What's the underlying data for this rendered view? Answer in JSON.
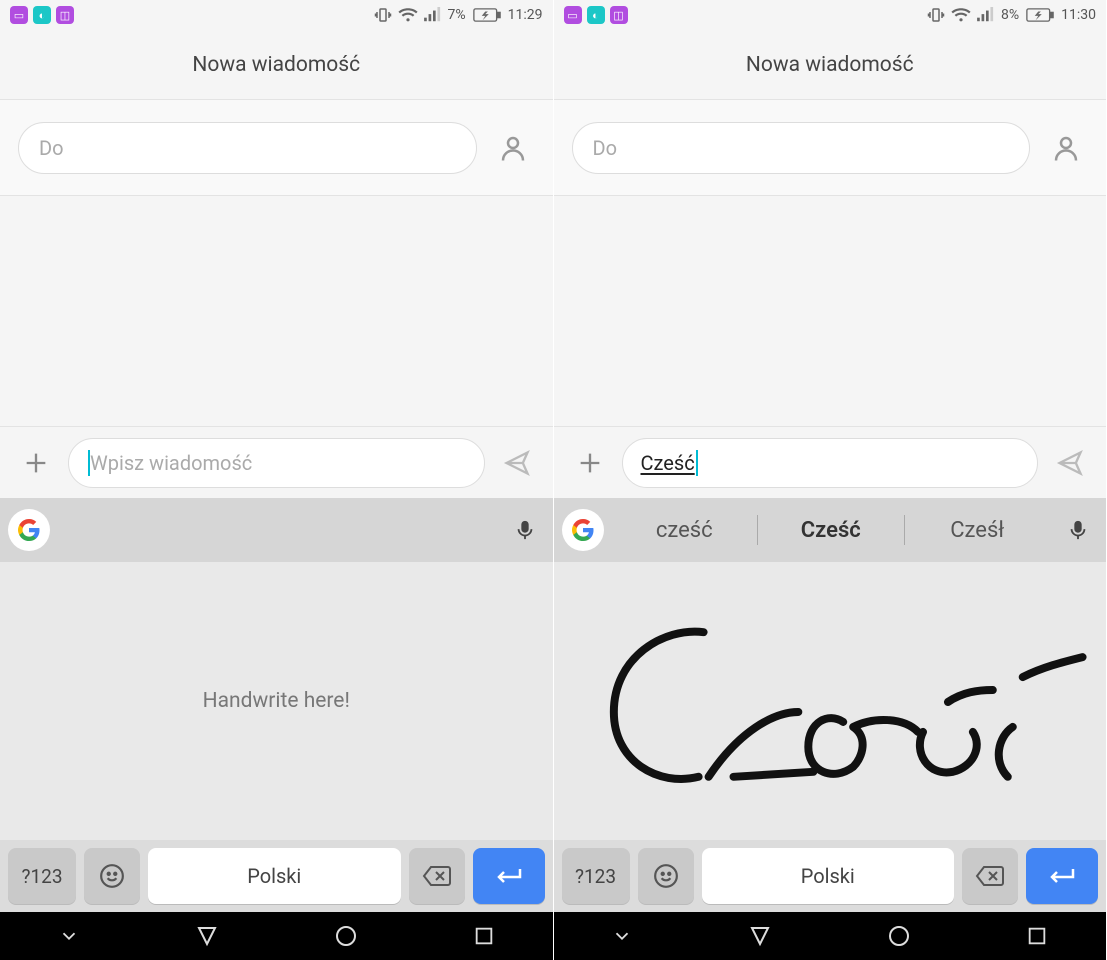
{
  "screens": [
    {
      "status": {
        "app_icons": [
          "chat",
          "android",
          "gallery"
        ],
        "app_icon_colors": [
          "#b14de0",
          "#1cc7c7",
          "#b14de0"
        ],
        "battery_text": "7%",
        "time": "11:29"
      },
      "header": {
        "title": "Nowa wiadomość"
      },
      "recipient": {
        "placeholder": "Do"
      },
      "compose": {
        "placeholder": "Wpisz wiadomość",
        "value": ""
      },
      "suggestions": [],
      "handwriting": {
        "prompt": "Handwrite here!",
        "has_ink": false
      },
      "keyboard": {
        "numeric_label": "?123",
        "space_label": "Polski"
      }
    },
    {
      "status": {
        "app_icons": [
          "chat",
          "android",
          "gallery"
        ],
        "app_icon_colors": [
          "#b14de0",
          "#1cc7c7",
          "#b14de0"
        ],
        "battery_text": "8%",
        "time": "11:30"
      },
      "header": {
        "title": "Nowa wiadomość"
      },
      "recipient": {
        "placeholder": "Do"
      },
      "compose": {
        "placeholder": "Wpisz wiadomość",
        "value": "Cześć"
      },
      "suggestions": [
        "cześć",
        "Cześć",
        "Cześł"
      ],
      "handwriting": {
        "prompt": "",
        "has_ink": true
      },
      "keyboard": {
        "numeric_label": "?123",
        "space_label": "Polski"
      }
    }
  ],
  "icons": {
    "contact": "person",
    "send": "send",
    "plus": "plus",
    "mic": "mic",
    "emoji": "smile",
    "backspace": "backspace",
    "enter": "enter"
  }
}
